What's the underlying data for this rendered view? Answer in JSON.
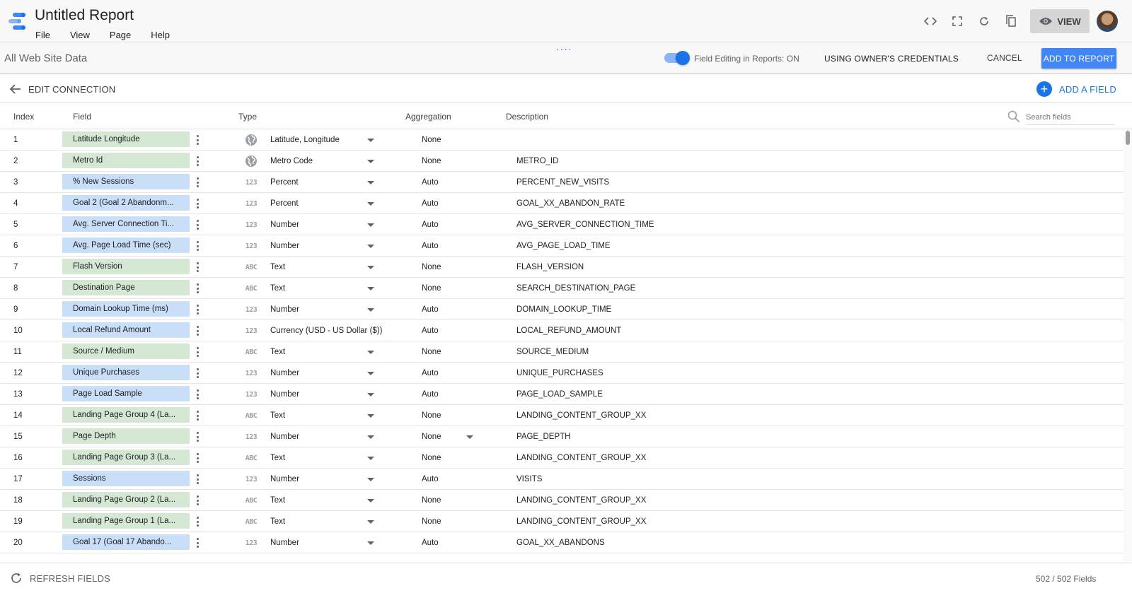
{
  "app": {
    "title": "Untitled Report",
    "menu": [
      "File",
      "View",
      "Page",
      "Help"
    ],
    "view_label": "VIEW"
  },
  "datasource": {
    "name": "All Web Site Data",
    "field_editing": "Field Editing in Reports: ON",
    "field_editing_on": true,
    "credentials": "USING OWNER'S CREDENTIALS",
    "cancel": "CANCEL",
    "add_to_report": "ADD TO REPORT"
  },
  "connection": {
    "back_label": "EDIT CONNECTION",
    "add_field": "ADD A FIELD"
  },
  "columns": {
    "index": "Index",
    "field": "Field",
    "type": "Type",
    "aggregation": "Aggregation",
    "description": "Description",
    "search_placeholder": "Search fields"
  },
  "rows": [
    {
      "index": "1",
      "field": "Latitude Longitude",
      "kind": "dimension",
      "type_icon": "globe",
      "type": "Latitude, Longitude",
      "caret": true,
      "aggregation": "None",
      "description": ""
    },
    {
      "index": "2",
      "field": "Metro Id",
      "kind": "dimension",
      "type_icon": "globe",
      "type": "Metro Code",
      "caret": true,
      "aggregation": "None",
      "description": "METRO_ID"
    },
    {
      "index": "3",
      "field": "% New Sessions",
      "kind": "metric",
      "type_icon": "123",
      "type": "Percent",
      "caret": true,
      "aggregation": "Auto",
      "description": "PERCENT_NEW_VISITS"
    },
    {
      "index": "4",
      "field": "Goal 2 (Goal 2 Abandonm...",
      "kind": "metric",
      "type_icon": "123",
      "type": "Percent",
      "caret": true,
      "aggregation": "Auto",
      "description": "GOAL_XX_ABANDON_RATE"
    },
    {
      "index": "5",
      "field": "Avg. Server Connection Ti...",
      "kind": "metric",
      "type_icon": "123",
      "type": "Number",
      "caret": true,
      "aggregation": "Auto",
      "description": "AVG_SERVER_CONNECTION_TIME"
    },
    {
      "index": "6",
      "field": "Avg. Page Load Time (sec)",
      "kind": "metric",
      "type_icon": "123",
      "type": "Number",
      "caret": true,
      "aggregation": "Auto",
      "description": "AVG_PAGE_LOAD_TIME"
    },
    {
      "index": "7",
      "field": "Flash Version",
      "kind": "dimension",
      "type_icon": "ABC",
      "type": "Text",
      "caret": true,
      "aggregation": "None",
      "description": "FLASH_VERSION"
    },
    {
      "index": "8",
      "field": "Destination Page",
      "kind": "dimension",
      "type_icon": "ABC",
      "type": "Text",
      "caret": true,
      "aggregation": "None",
      "description": "SEARCH_DESTINATION_PAGE"
    },
    {
      "index": "9",
      "field": "Domain Lookup Time (ms)",
      "kind": "metric",
      "type_icon": "123",
      "type": "Number",
      "caret": true,
      "aggregation": "Auto",
      "description": "DOMAIN_LOOKUP_TIME"
    },
    {
      "index": "10",
      "field": "Local Refund Amount",
      "kind": "metric",
      "type_icon": "123",
      "type": "Currency (USD - US Dollar ($))",
      "caret": false,
      "aggregation": "Auto",
      "description": "LOCAL_REFUND_AMOUNT"
    },
    {
      "index": "11",
      "field": "Source / Medium",
      "kind": "dimension",
      "type_icon": "ABC",
      "type": "Text",
      "caret": true,
      "aggregation": "None",
      "description": "SOURCE_MEDIUM"
    },
    {
      "index": "12",
      "field": "Unique Purchases",
      "kind": "metric",
      "type_icon": "123",
      "type": "Number",
      "caret": true,
      "aggregation": "Auto",
      "description": "UNIQUE_PURCHASES"
    },
    {
      "index": "13",
      "field": "Page Load Sample",
      "kind": "metric",
      "type_icon": "123",
      "type": "Number",
      "caret": true,
      "aggregation": "Auto",
      "description": "PAGE_LOAD_SAMPLE"
    },
    {
      "index": "14",
      "field": "Landing Page Group 4 (La...",
      "kind": "dimension",
      "type_icon": "ABC",
      "type": "Text",
      "caret": true,
      "aggregation": "None",
      "description": "LANDING_CONTENT_GROUP_XX"
    },
    {
      "index": "15",
      "field": "Page Depth",
      "kind": "dimension",
      "type_icon": "123",
      "type": "Number",
      "caret": true,
      "aggregation": "None",
      "agg_caret": true,
      "description": "PAGE_DEPTH"
    },
    {
      "index": "16",
      "field": "Landing Page Group 3 (La...",
      "kind": "dimension",
      "type_icon": "ABC",
      "type": "Text",
      "caret": true,
      "aggregation": "None",
      "description": "LANDING_CONTENT_GROUP_XX"
    },
    {
      "index": "17",
      "field": "Sessions",
      "kind": "metric",
      "type_icon": "123",
      "type": "Number",
      "caret": true,
      "aggregation": "Auto",
      "description": "VISITS"
    },
    {
      "index": "18",
      "field": "Landing Page Group 2 (La...",
      "kind": "dimension",
      "type_icon": "ABC",
      "type": "Text",
      "caret": true,
      "aggregation": "None",
      "description": "LANDING_CONTENT_GROUP_XX"
    },
    {
      "index": "19",
      "field": "Landing Page Group 1 (La...",
      "kind": "dimension",
      "type_icon": "ABC",
      "type": "Text",
      "caret": true,
      "aggregation": "None",
      "description": "LANDING_CONTENT_GROUP_XX"
    },
    {
      "index": "20",
      "field": "Goal 17 (Goal 17 Abando...",
      "kind": "metric",
      "type_icon": "123",
      "type": "Number",
      "caret": true,
      "aggregation": "Auto",
      "description": "GOAL_XX_ABANDONS"
    }
  ],
  "footer": {
    "refresh_label": "REFRESH FIELDS",
    "field_count": "502 / 502 Fields"
  },
  "colors": {
    "accent": "#1a73e8",
    "dimension_chip": "#d5e8d4",
    "metric_chip": "#c9dff8",
    "primary_button": "#4285f4"
  }
}
